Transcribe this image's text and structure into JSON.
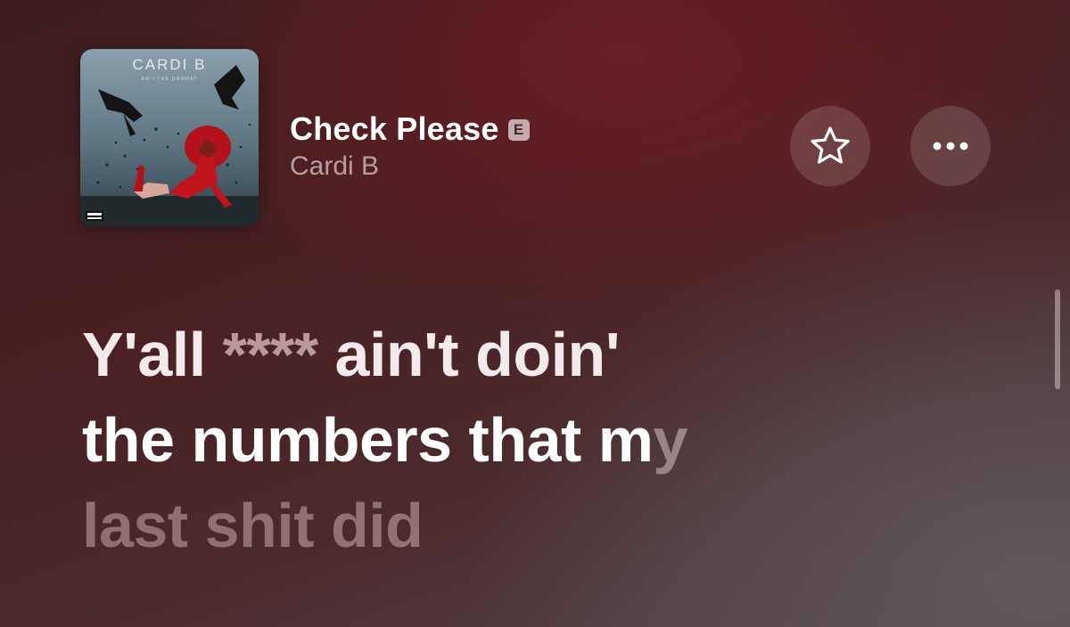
{
  "track": {
    "album_cover": {
      "artist_text": "CARDI B",
      "album_text": "AM I THE DRAMA?"
    },
    "title": "Check Please",
    "explicit_badge": "E",
    "artist": "Cardi B"
  },
  "actions": {
    "favorite_icon": "star-icon",
    "more_icon": "more-icon"
  },
  "lyrics": {
    "line1": {
      "part1": "Y'all",
      "part2": " **** ",
      "part3": "ain't doin'"
    },
    "line2": {
      "sung": "the numbers that m",
      "unsung": "y"
    },
    "line3": "last shit did"
  },
  "colors": {
    "background_top": "#4a1f22",
    "background_bottom": "#55494e",
    "explicit_badge_bg": "#e3d8d9"
  }
}
